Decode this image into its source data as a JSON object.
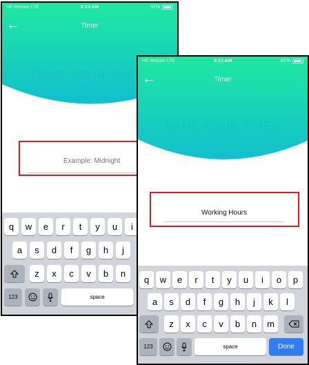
{
  "colors": {
    "gradient_top": "#1ee8a0",
    "gradient_bottom": "#12bfcf",
    "accent_text": "#16c3c7",
    "highlight_box": "#e8161c",
    "done_key": "#2f7cf6"
  },
  "back_screen": {
    "status": {
      "carrier": "••ll Verizon  LTE",
      "time": "9:13 AM",
      "battery": "81%"
    },
    "nav_title": "Timer",
    "headline": "NAME YOUR TIMER",
    "input": {
      "value": "",
      "placeholder": "Example: Midnight"
    },
    "keyboard": {
      "row1": [
        "q",
        "w",
        "e",
        "r",
        "t",
        "y",
        "u",
        "i"
      ],
      "row2": [
        "a",
        "s",
        "d",
        "f",
        "g",
        "h",
        "j"
      ],
      "row3": [
        "z",
        "x",
        "c",
        "v",
        "b",
        "n"
      ],
      "numbers_key": "123",
      "space_key": "space"
    }
  },
  "front_screen": {
    "status": {
      "carrier": "••ll Verizon  LTE",
      "time": "9:13 AM",
      "battery": "81%"
    },
    "nav_title": "Timer",
    "headline": "NAME YOUR TIMER",
    "input": {
      "value": "Working Hours",
      "placeholder": "Example: Midnight"
    },
    "keyboard": {
      "row1": [
        "q",
        "w",
        "e",
        "r",
        "t",
        "y",
        "u",
        "i",
        "o",
        "p"
      ],
      "row2": [
        "a",
        "s",
        "d",
        "f",
        "g",
        "h",
        "j",
        "k",
        "l"
      ],
      "row3": [
        "z",
        "x",
        "c",
        "v",
        "b",
        "n",
        "m"
      ],
      "numbers_key": "123",
      "space_key": "space",
      "done_key": "Done"
    }
  }
}
